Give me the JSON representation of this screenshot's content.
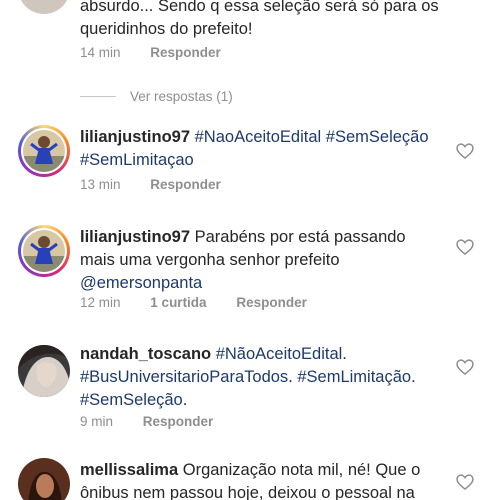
{
  "top_comment": {
    "text_partial": "absurdo... Sendo q essa seleção será só para os queridinhos do prefeito!",
    "time": "14 min",
    "reply_label": "Responder",
    "view_replies": "Ver respostas (1)"
  },
  "comments": [
    {
      "username": "lilianjustino97",
      "text": "#NaoAceitoEdital #SemSeleção #SemLimitaçao",
      "time": "13 min",
      "reply_label": "Responder"
    },
    {
      "username": "lilianjustino97",
      "text": "Parabéns por está passando mais uma vergonha senhor prefeito",
      "mention": "@emersonpanta",
      "time": "12 min",
      "likes": "1 curtida",
      "reply_label": "Responder"
    },
    {
      "username": "nandah_toscano",
      "tag1": "#NãoAceitoEdital",
      "tag2": "#BusUniversitarioParaTodos",
      "tag3": "#SemLimitação",
      "tag4": "#SemSeleção",
      "time": "9 min",
      "reply_label": "Responder"
    },
    {
      "username": "mellissalima",
      "text": "Organização nota mil, né! Que o ônibus nem passou hoje, deixou o pessoal na"
    }
  ],
  "colors": {
    "hashtag": "#1d3a6a",
    "meta": "#8e8e8e",
    "text": "#262626"
  },
  "icons": [
    "heart-outline-icon"
  ]
}
